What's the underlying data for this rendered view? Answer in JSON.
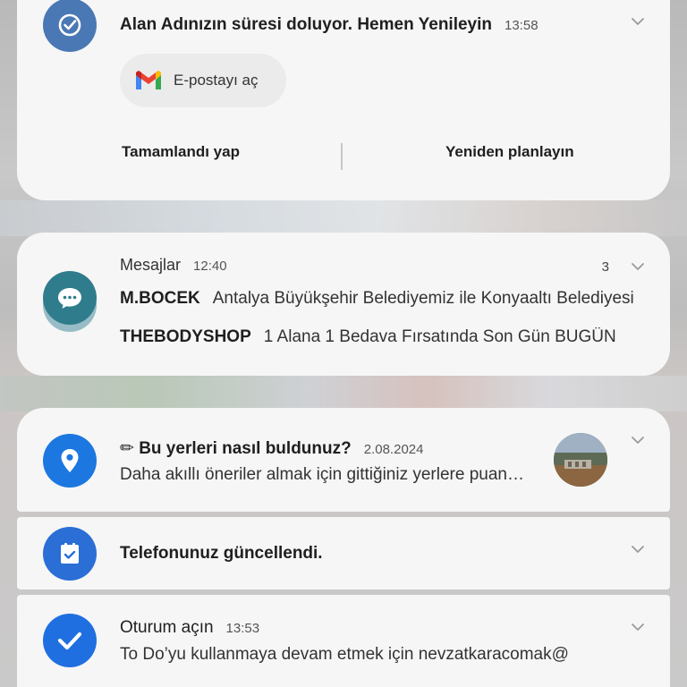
{
  "notifications": {
    "domain_alert": {
      "title": "Alan Adınızın süresi doluyor. Hemen Yenileyin",
      "time": "13:58",
      "email_action_label": "E-postayı aç",
      "action_done": "Tamamlandı yap",
      "action_reschedule": "Yeniden planlayın"
    },
    "messages": {
      "app_name": "Mesajlar",
      "time": "12:40",
      "count": "3",
      "items": [
        {
          "sender": "M.BOCEK",
          "text": "Antalya Büyükşehir Belediyemiz ile Konyaaltı Belediyesi"
        },
        {
          "sender": "THEBODYSHOP",
          "text": "1 Alana 1 Bedava Fırsatında Son Gün BUGÜN"
        }
      ]
    },
    "places": {
      "title": "✏ Bu yerleri nasıl buldunuz?",
      "date": "2.08.2024",
      "text": "Daha akıllı öneriler almak için gittiğiniz yerlere puan verin"
    },
    "update": {
      "title": "Telefonunuz güncellendi."
    },
    "todo": {
      "title": "Oturum açın",
      "time": "13:53",
      "text": "To Do’yu kullanmaya devam etmek için nevzatkaracomak@"
    }
  },
  "icons": {
    "domain": "check-circle-icon",
    "messages": "chat-bubble-icon",
    "places": "location-pin-icon",
    "update": "calendar-check-icon",
    "todo": "checkmark-icon",
    "gmail": "gmail-icon",
    "expand": "chevron-down-icon"
  },
  "colors": {
    "card_bg": "#f6f6f6",
    "domain_icon": "#4a78b5",
    "messages_icon": "#2f7c8c",
    "places_icon": "#1d77e0",
    "update_icon": "#2a6ed6",
    "todo_icon": "#1f6fe1"
  }
}
